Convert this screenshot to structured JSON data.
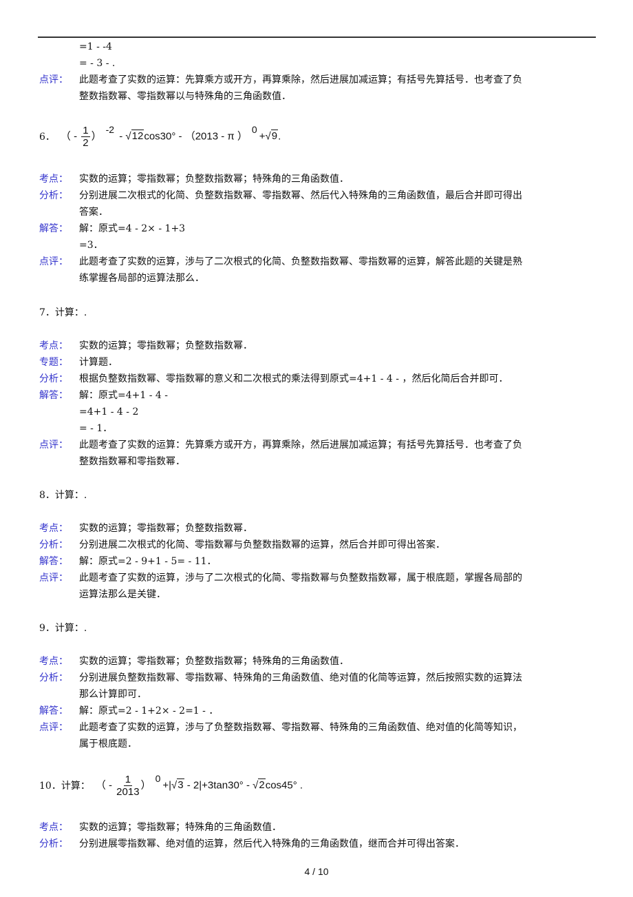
{
  "label_color": "#3333cc",
  "page_number": "4 / 10",
  "intro": {
    "lines": [
      "=1 - -4",
      "= - 3 - ."
    ],
    "entries": [
      {
        "label": "点评：",
        "lines": [
          "此题考查了实数的运算：先算乘方或开方，再算乘除，然后进展加减运算；有括号先算括号．也考查了负",
          "整数指数幂、零指数幂以与特殊角的三角函数值．"
        ]
      }
    ]
  },
  "questions": [
    {
      "number": "6．",
      "formula": [
        {
          "t": "text",
          "v": "（ - "
        },
        {
          "t": "frac",
          "n": "1",
          "d": "2"
        },
        {
          "t": "text",
          "v": "）"
        },
        {
          "t": "sup",
          "v": "-2"
        },
        {
          "t": "text",
          "v": " - "
        },
        {
          "t": "sqrt",
          "v": "12"
        },
        {
          "t": "text",
          "v": "cos30°  - （2013 - π ）"
        },
        {
          "t": "sup",
          "v": "0"
        },
        {
          "t": "text",
          "v": "+"
        },
        {
          "t": "sqrt",
          "v": "9"
        },
        {
          "t": "text",
          "v": "."
        }
      ],
      "entries": [
        {
          "label": "考点：",
          "lines": [
            "实数的运算；零指数幂；负整数指数幂；特殊角的三角函数值．"
          ]
        },
        {
          "label": "分析：",
          "lines": [
            "分别进展二次根式的化简、负整数指数幂、零指数幂、然后代入特殊角的三角函数值，最后合并即可得出",
            "答案．"
          ]
        },
        {
          "label": "解答：",
          "lines": [
            "解：原式=4 - 2× - 1+3",
            "=3．"
          ]
        },
        {
          "label": "点评：",
          "lines": [
            "此题考查了实数的运算，涉与了二次根式的化简、负整数指数幂、零指数幂的运算，解答此题的关键是熟",
            "练掌握各局部的运算法那么．"
          ]
        }
      ]
    },
    {
      "number": "7．",
      "prompt": "计算：.",
      "entries": [
        {
          "label": "考点：",
          "lines": [
            "实数的运算；零指数幂；负整数指数幂．"
          ]
        },
        {
          "label": "专题：",
          "lines": [
            "计算题．"
          ]
        },
        {
          "label": "分析：",
          "lines": [
            "根据负整数指数幂、零指数幂的意义和二次根式的乘法得到原式=4+1 - 4 - ，然后化简后合并即可．"
          ]
        },
        {
          "label": "解答：",
          "lines": [
            "解：原式=4+1 - 4 - ",
            "=4+1 - 4 - 2",
            "= - 1．"
          ]
        },
        {
          "label": "点评：",
          "lines": [
            "此题考查了实数的运算：先算乘方或开方，再算乘除，然后进展加减运算；有括号先算括号．也考查了负",
            "整数指数幂和零指数幂．"
          ]
        }
      ]
    },
    {
      "number": "8．",
      "prompt": "计算：.",
      "entries": [
        {
          "label": "考点：",
          "lines": [
            "实数的运算；零指数幂；负整数指数幂．"
          ]
        },
        {
          "label": "分析：",
          "lines": [
            "分别进展二次根式的化简、零指数幂与负整数指数幂的运算，然后合并即可得出答案．"
          ]
        },
        {
          "label": "解答：",
          "lines": [
            "解：原式=2 - 9+1 - 5= - 11．"
          ]
        },
        {
          "label": "点评：",
          "lines": [
            "此题考查了实数的运算，涉与了二次根式的化简、零指数幂与负整数指数幂，属于根底题，掌握各局部的",
            "运算法那么是关键．"
          ]
        }
      ]
    },
    {
      "number": "9．",
      "prompt": "计算：.",
      "entries": [
        {
          "label": "考点：",
          "lines": [
            "实数的运算；零指数幂；负整数指数幂；特殊角的三角函数值．"
          ]
        },
        {
          "label": "分析：",
          "lines": [
            "分别进展负整数指数幂、零指数幂、特殊角的三角函数值、绝对值的化简等运算，然后按照实数的运算法",
            "那么计算即可．"
          ]
        },
        {
          "label": "解答：",
          "lines": [
            "解：原式=2 - 1+2× - 2=1 - ．"
          ]
        },
        {
          "label": "点评：",
          "lines": [
            "此题考查了实数的运算，涉与了负整数指数幂、零指数幂、特殊角的三角函数值、绝对值的化简等知识，",
            "属于根底题．"
          ]
        }
      ]
    },
    {
      "number": "10．计算：",
      "formula": [
        {
          "t": "text",
          "v": "（ - "
        },
        {
          "t": "frac",
          "n": "1",
          "d": "2013"
        },
        {
          "t": "text",
          "v": "）"
        },
        {
          "t": "sup",
          "v": "0"
        },
        {
          "t": "text",
          "v": "+|"
        },
        {
          "t": "sqrt",
          "v": "3"
        },
        {
          "t": "text",
          "v": " - 2|+3tan30°  - "
        },
        {
          "t": "sqrt",
          "v": "2"
        },
        {
          "t": "text",
          "v": "cos45°  ."
        }
      ],
      "entries": [
        {
          "label": "考点：",
          "lines": [
            "实数的运算；零指数幂；特殊角的三角函数值．"
          ]
        },
        {
          "label": "分析：",
          "lines": [
            "分别进展零指数幂、绝对值的运算，然后代入特殊角的三角函数值，继而合并可得出答案．"
          ]
        }
      ]
    }
  ]
}
